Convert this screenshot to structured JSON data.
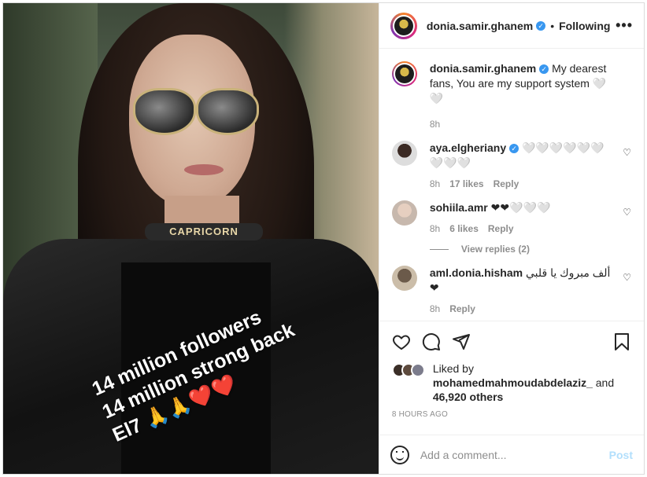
{
  "header": {
    "username": "donia.samir.ghanem",
    "verified_mark": "✓",
    "separator": "•",
    "follow_state": "Following",
    "more": "•••"
  },
  "photo": {
    "choker_text": "CAPRICORN",
    "overlay_lines": [
      "14 million followers",
      "14 million strong back",
      "El7 🙏🙏❤️❤️"
    ]
  },
  "caption": {
    "username": "donia.samir.ghanem",
    "text": " My dearest fans, You are my support system 🤍🤍",
    "time": "8h"
  },
  "comments": [
    {
      "username": "aya.elgheriany",
      "verified": true,
      "text": " 🤍🤍🤍🤍🤍🤍🤍🤍🤍",
      "time": "8h",
      "likes": "17 likes",
      "reply": "Reply"
    },
    {
      "username": "sohiila.amr",
      "verified": false,
      "text": " ❤❤🤍🤍🤍",
      "time": "8h",
      "likes": "6 likes",
      "reply": "Reply"
    },
    {
      "username": "aml.donia.hisham",
      "verified": false,
      "text": " ألف مبروك يا قلبي ❤",
      "time": "8h",
      "likes": "",
      "reply": "Reply"
    }
  ],
  "view_replies": "View replies (2)",
  "liked_by": {
    "prefix": "Liked by",
    "user": "mohamedmahmoudabdelaziz_",
    "and": " and",
    "others": "46,920 others"
  },
  "timestamp": "8 HOURS AGO",
  "add_comment": {
    "placeholder": "Add a comment...",
    "post_label": "Post"
  },
  "icons": [
    "heart-icon",
    "comment-icon",
    "share-icon",
    "bookmark-icon",
    "emoji-icon",
    "more-icon"
  ]
}
